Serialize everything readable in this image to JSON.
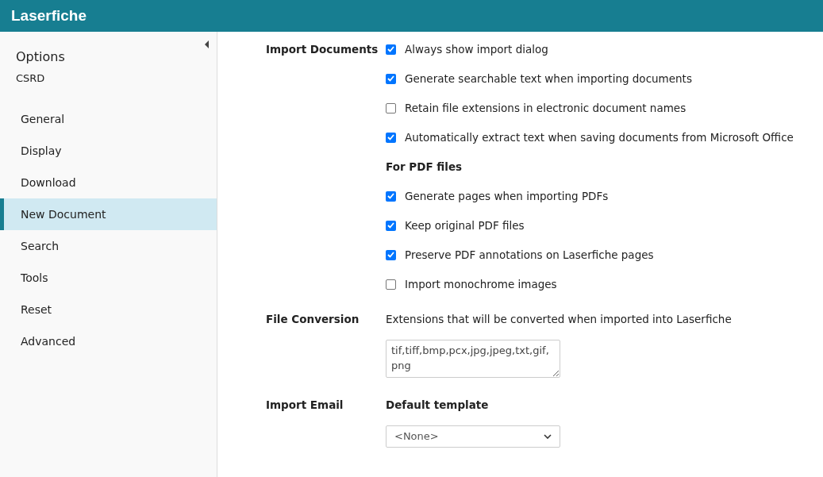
{
  "header": {
    "logo": "Laserfiche"
  },
  "sidebar": {
    "title": "Options",
    "subtitle": "CSRD",
    "items": [
      {
        "label": "General",
        "selected": false
      },
      {
        "label": "Display",
        "selected": false
      },
      {
        "label": "Download",
        "selected": false
      },
      {
        "label": "New Document",
        "selected": true
      },
      {
        "label": "Search",
        "selected": false
      },
      {
        "label": "Tools",
        "selected": false
      },
      {
        "label": "Reset",
        "selected": false
      },
      {
        "label": "Advanced",
        "selected": false
      }
    ]
  },
  "sections": [
    {
      "label": "Import Documents",
      "items": [
        {
          "kind": "checkbox",
          "label": "Always show import dialog",
          "checked": true
        },
        {
          "kind": "checkbox",
          "label": "Generate searchable text when importing documents",
          "checked": true
        },
        {
          "kind": "checkbox",
          "label": "Retain file extensions in electronic document names",
          "checked": false
        },
        {
          "kind": "checkbox",
          "label": "Automatically extract text when saving documents from Microsoft Office",
          "checked": true
        },
        {
          "kind": "heading",
          "label": "For PDF files"
        },
        {
          "kind": "checkbox",
          "label": "Generate pages when importing PDFs",
          "checked": true
        },
        {
          "kind": "checkbox",
          "label": "Keep original PDF files",
          "checked": true
        },
        {
          "kind": "checkbox",
          "label": "Preserve PDF annotations on Laserfiche pages",
          "checked": true
        },
        {
          "kind": "checkbox",
          "label": "Import monochrome images",
          "checked": false
        }
      ]
    },
    {
      "label": "File Conversion",
      "items": [
        {
          "kind": "text",
          "label": "Extensions that will be converted when imported into Laserfiche"
        },
        {
          "kind": "textarea",
          "value": "tif,tiff,bmp,pcx,jpg,jpeg,txt,gif,png"
        }
      ]
    },
    {
      "label": "Import Email",
      "items": [
        {
          "kind": "heading",
          "label": "Default template"
        },
        {
          "kind": "select",
          "value": "<None>"
        }
      ]
    }
  ]
}
